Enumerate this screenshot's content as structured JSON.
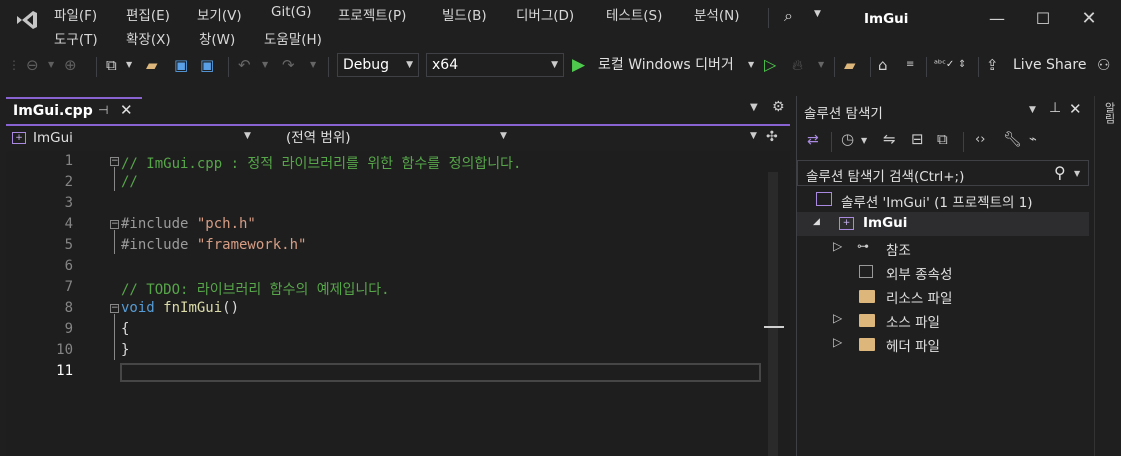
{
  "menubar": {
    "row1": [
      "파일(F)",
      "편집(E)",
      "보기(V)",
      "Git(G)",
      "프로젝트(P)",
      "빌드(B)",
      "디버그(D)",
      "테스트(S)",
      "분석(N)"
    ],
    "row2": [
      "도구(T)",
      "확장(X)",
      "창(W)",
      "도움말(H)"
    ],
    "title": "ImGui"
  },
  "toolbar": {
    "config": "Debug",
    "platform": "x64",
    "run_label": "로컬 Windows 디버거",
    "live_share": "Live Share"
  },
  "editor": {
    "tab_label": "ImGui.cpp",
    "nav_project": "ImGui",
    "nav_scope": "(전역 범위)",
    "line_numbers": [
      "1",
      "2",
      "3",
      "4",
      "5",
      "6",
      "7",
      "8",
      "9",
      "10",
      "11"
    ],
    "lines": {
      "l1": "// ImGui.cpp : 정적 라이브러리를 위한 함수를 정의합니다.",
      "l2": "//",
      "l4_kw": "#include ",
      "l4_str": "\"pch.h\"",
      "l5_kw": "#include ",
      "l5_str": "\"framework.h\"",
      "l7": "// TODO: 라이브러리 함수의 예제입니다.",
      "l8_kw": "void ",
      "l8_fn": "fnImGui",
      "l8_rest": "()",
      "l9": "{",
      "l10": "}"
    }
  },
  "solution": {
    "panel_title": "솔루션 탐색기",
    "search_placeholder": "솔루션 탐색기 검색(Ctrl+;)",
    "solution_label": "솔루션 'ImGui'  (1 프로젝트의 1)",
    "project": "ImGui",
    "items": [
      {
        "label": "참조",
        "expandable": true
      },
      {
        "label": "외부 종속성",
        "expandable": false
      },
      {
        "label": "리소스 파일",
        "expandable": false
      },
      {
        "label": "소스 파일",
        "expandable": true
      },
      {
        "label": "헤더 파일",
        "expandable": true
      }
    ]
  },
  "rightbar": {
    "label": "알림"
  },
  "colors": {
    "accent": "#8a63d2",
    "comment": "#57a64a",
    "keyword": "#569cd6",
    "string": "#d69d85",
    "function": "#dcdcaa",
    "run": "#4ec94e"
  }
}
